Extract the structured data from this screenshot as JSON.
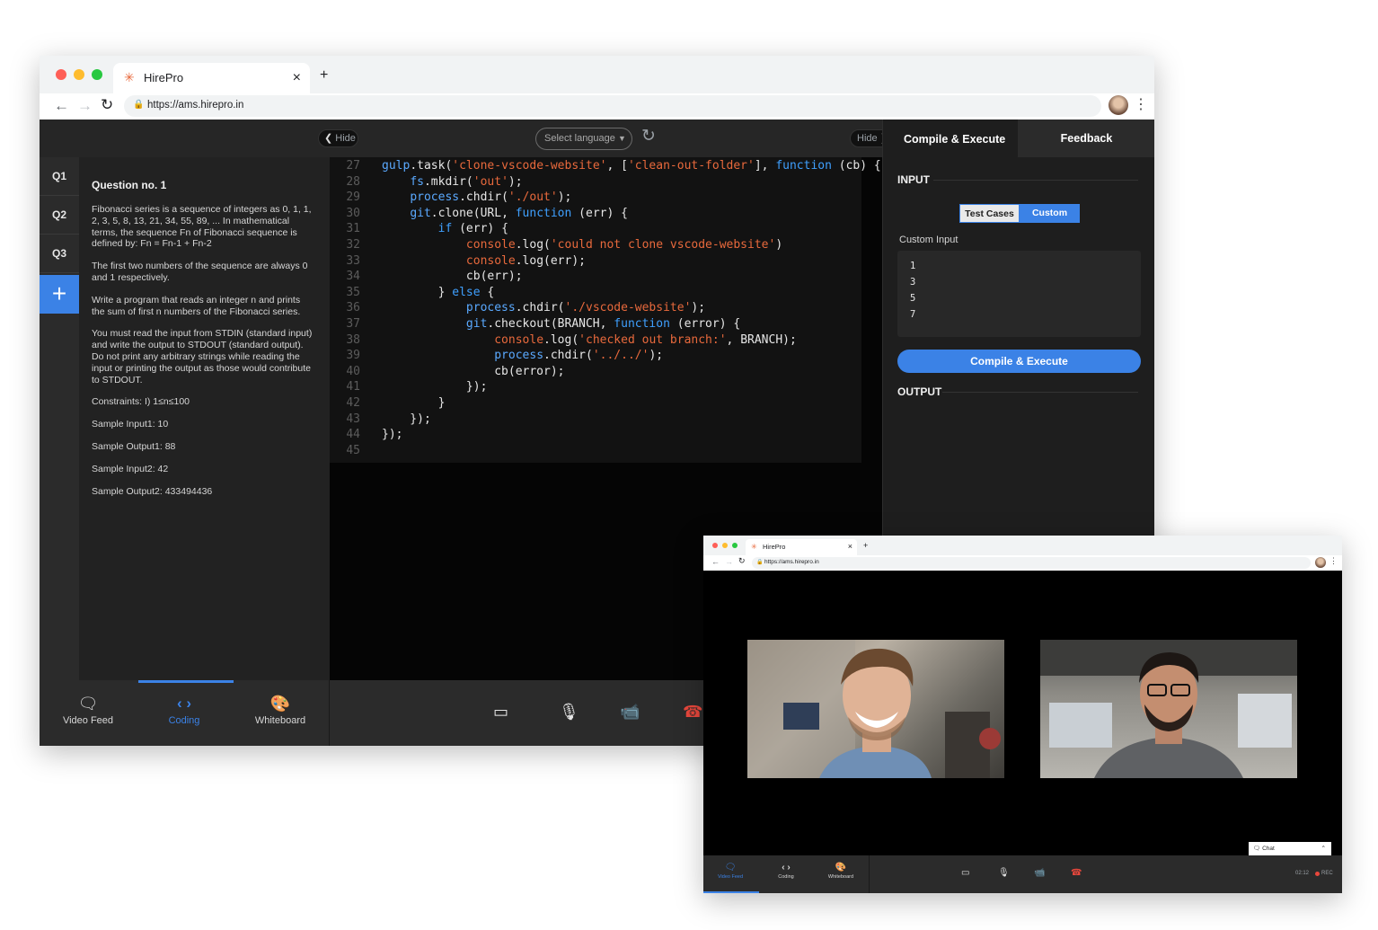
{
  "main_window": {
    "tab_title": "HirePro",
    "tab_close": "×",
    "new_tab": "+",
    "url": "https://ams.hirepro.in",
    "hide_left": "Hide",
    "hide_right": "Hide",
    "select_language": "Select language",
    "questions": [
      "Q1",
      "Q2",
      "Q3"
    ],
    "add_label": "+",
    "question_title": "Question no. 1",
    "question_paragraphs": [
      "Fibonacci series is a sequence of integers as 0, 1, 1, 2, 3, 5, 8, 13, 21, 34, 55, 89, ... In mathematical terms, the sequence Fn of Fibonacci sequence is defined by: Fn = Fn-1 + Fn-2",
      "The first two numbers of the sequence are always 0 and 1 respectively.",
      "Write a program that reads an integer n and prints the sum of first n numbers of the Fibonacci series.",
      "You must read the input from STDIN (standard input) and write the output to STDOUT (standard output). Do not print any arbitrary strings while reading the input or printing the output as those would contribute to STDOUT.",
      "Constraints: I) 1≤n≤100",
      "Sample Input1: 10",
      "Sample Output1: 88",
      "Sample Input2: 42",
      "Sample Output2: 433494436"
    ],
    "code_lines": [
      {
        "n": "27",
        "html": "<span class='fn'>gulp</span><span class='pl'>.task(</span><span class='str'>'clone-vscode-website'</span><span class='pl'>, [</span><span class='str'>'clean-out-folder'</span><span class='pl'>], </span><span class='kw'>function</span><span class='pl'> (cb) {</span>"
      },
      {
        "n": "28",
        "html": "<span class='pl'>    </span><span class='fn'>fs</span><span class='pl'>.mkdir(</span><span class='str'>'out'</span><span class='pl'>);</span>"
      },
      {
        "n": "29",
        "html": "<span class='pl'>    </span><span class='fn'>process</span><span class='pl'>.chdir(</span><span class='str'>'./out'</span><span class='pl'>);</span>"
      },
      {
        "n": "30",
        "html": "<span class='pl'>    </span><span class='fn'>git</span><span class='pl'>.clone(URL, </span><span class='kw'>function</span><span class='pl'> (err) {</span>"
      },
      {
        "n": "31",
        "html": "<span class='pl'>        </span><span class='kw'>if</span><span class='pl'> (err) {</span>"
      },
      {
        "n": "32",
        "html": "<span class='pl'>            </span><span class='str'>console</span><span class='pl'>.log(</span><span class='str'>'could not clone vscode-website'</span><span class='pl'>)</span>"
      },
      {
        "n": "33",
        "html": "<span class='pl'>            </span><span class='str'>console</span><span class='pl'>.log(err);</span>"
      },
      {
        "n": "34",
        "html": "<span class='pl'>            cb(err);</span>"
      },
      {
        "n": "35",
        "html": "<span class='pl'>        } </span><span class='kw'>else</span><span class='pl'> {</span>"
      },
      {
        "n": "36",
        "html": "<span class='pl'>            </span><span class='fn'>process</span><span class='pl'>.chdir(</span><span class='str'>'./vscode-website'</span><span class='pl'>);</span>"
      },
      {
        "n": "37",
        "html": "<span class='pl'>            </span><span class='fn'>git</span><span class='pl'>.checkout(BRANCH, </span><span class='kw'>function</span><span class='pl'> (error) {</span>"
      },
      {
        "n": "38",
        "html": "<span class='pl'>                </span><span class='str'>console</span><span class='pl'>.log(</span><span class='str'>'checked out branch:'</span><span class='pl'>, BRANCH);</span>"
      },
      {
        "n": "39",
        "html": "<span class='pl'>                </span><span class='fn'>process</span><span class='pl'>.chdir(</span><span class='str'>'../../'</span><span class='pl'>);</span>"
      },
      {
        "n": "40",
        "html": "<span class='pl'>                cb(error);</span>"
      },
      {
        "n": "41",
        "html": "<span class='pl'>            });</span>"
      },
      {
        "n": "42",
        "html": "<span class='pl'>        }</span>"
      },
      {
        "n": "43",
        "html": "<span class='pl'>    });</span>"
      },
      {
        "n": "44",
        "html": "<span class='pl'>});</span>"
      },
      {
        "n": "45",
        "html": ""
      }
    ],
    "right_tabs": {
      "compile": "Compile & Execute",
      "feedback": "Feedback"
    },
    "input_heading": "INPUT",
    "toggle": {
      "test_cases": "Test Cases",
      "custom": "Custom"
    },
    "custom_input_label": "Custom Input",
    "custom_input_values": [
      "1",
      "3",
      "5",
      "7"
    ],
    "compile_button": "Compile & Execute",
    "output_heading": "OUTPUT",
    "bottom_nav": [
      {
        "label": "Video Feed",
        "icon": "chat-icon"
      },
      {
        "label": "Coding",
        "icon": "code-icon"
      },
      {
        "label": "Whiteboard",
        "icon": "palette-icon"
      }
    ],
    "active_nav": "Coding"
  },
  "video_window": {
    "tab_title": "HirePro",
    "tab_close": "×",
    "new_tab": "+",
    "url": "https://ams.hirepro.in",
    "chat_label": "Chat",
    "bottom_nav": [
      {
        "label": "Video Feed",
        "icon": "chat-icon"
      },
      {
        "label": "Coding",
        "icon": "code-icon"
      },
      {
        "label": "Whiteboard",
        "icon": "palette-icon"
      }
    ],
    "active_nav": "Video Feed",
    "timer": "02:12",
    "rec": "REC"
  },
  "colors": {
    "accent": "#3b82e6",
    "dark_bg": "#1e1e1e",
    "panel_bg": "#262626",
    "end_call": "#e8473c"
  }
}
